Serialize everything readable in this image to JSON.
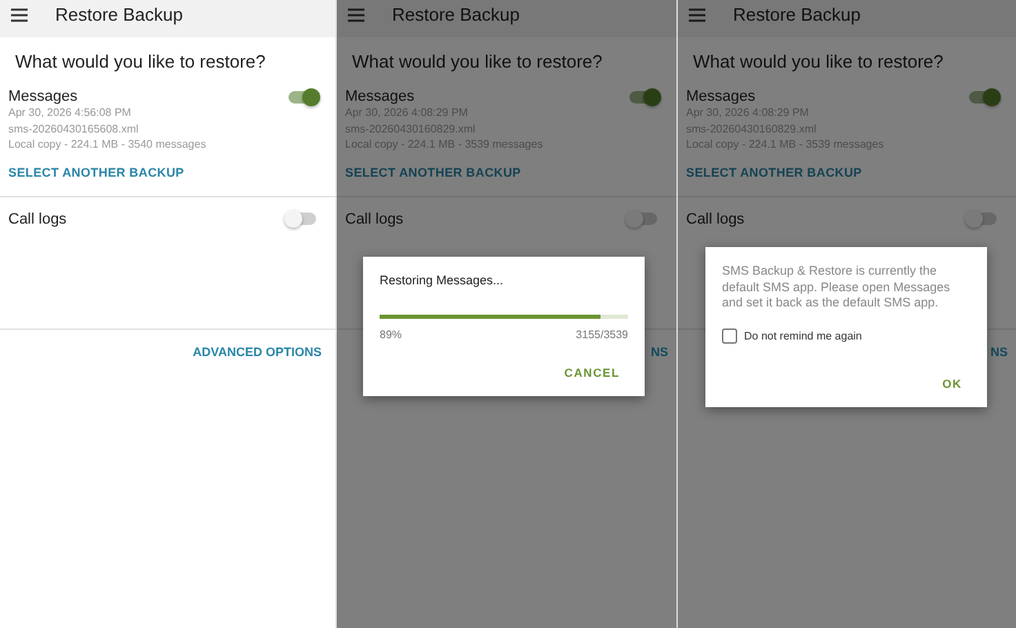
{
  "panels": [
    {
      "app_bar": {
        "title": "Restore Backup"
      },
      "question": "What would you like to restore?",
      "items": [
        {
          "kind": "backup",
          "name": "Messages",
          "on": true,
          "date": "Apr 30, 2026 4:56:08 PM",
          "file": "sms-20260430165608.xml",
          "details": "Local copy - 224.1 MB - 3540 messages",
          "link": "SELECT ANOTHER BACKUP"
        },
        {
          "kind": "simple",
          "name": "Call logs",
          "on": false
        }
      ],
      "advanced_options": "ADVANCED OPTIONS"
    },
    {
      "app_bar": {
        "title": "Restore Backup"
      },
      "question": "What would you like to restore?",
      "items": [
        {
          "kind": "backup",
          "name": "Messages",
          "on": true,
          "date": "Apr 30, 2026 4:08:29 PM",
          "file": "sms-20260430160829.xml",
          "details": "Local copy - 224.1 MB - 3539 messages",
          "link": "SELECT ANOTHER BACKUP"
        },
        {
          "kind": "simple",
          "name": "Call logs",
          "on": false
        }
      ],
      "advanced_options": "NS",
      "dialog": {
        "kind": "progress",
        "title": "Restoring Messages...",
        "level": 0.89,
        "percent": "89%",
        "count": "3155/3539",
        "button": "CANCEL"
      }
    },
    {
      "app_bar": {
        "title": "Restore Backup"
      },
      "question": "What would you like to restore?",
      "items": [
        {
          "kind": "backup",
          "name": "Messages",
          "on": true,
          "date": "Apr 30, 2026 4:08:29 PM",
          "file": "sms-20260430160829.xml",
          "details": "Local copy - 224.1 MB - 3539 messages",
          "link": "SELECT ANOTHER BACKUP"
        },
        {
          "kind": "simple",
          "name": "Call logs",
          "on": false
        }
      ],
      "advanced_options": "NS",
      "dialog": {
        "kind": "alert",
        "message": "SMS Backup & Restore is currently the default SMS app. Please open Messages and set it back as the default SMS app.",
        "checkbox": {
          "label": "Do not remind me again",
          "checked": false
        },
        "button": "OK"
      }
    }
  ]
}
